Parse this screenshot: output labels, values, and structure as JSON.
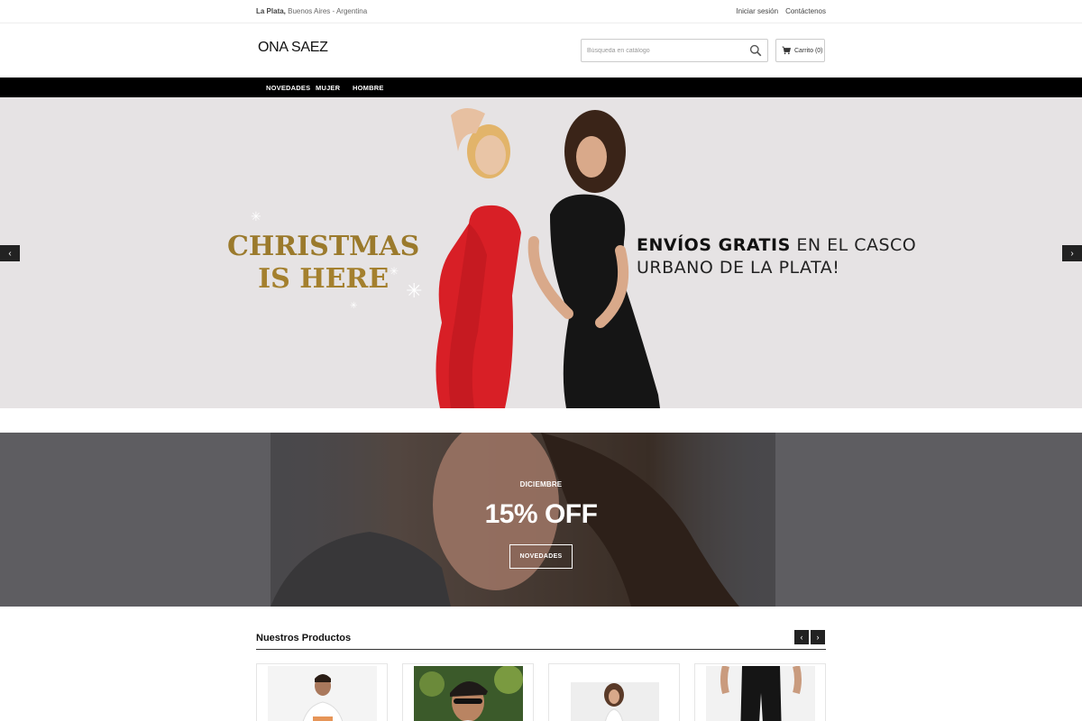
{
  "topbar": {
    "location_city": "La Plata,",
    "location_rest": " Buenos Aires - Argentina",
    "login": "Iniciar sesión",
    "contact": "Contáctenos"
  },
  "header": {
    "logo": "ONA SAEZ",
    "search_placeholder": "Búsqueda en catálogo",
    "cart_label": "Carrito (0)"
  },
  "nav": {
    "items": [
      "NOVEDADES",
      "MUJER",
      "HOMBRE"
    ]
  },
  "hero": {
    "xmas_line1": "CHRISTMAS",
    "xmas_line2": "IS HERE",
    "text_bold": "ENVÍOS GRATIS",
    "text_rest1": " EN EL CASCO",
    "text_line2": "URBANO DE LA PLATA!",
    "prev": "‹",
    "next": "›"
  },
  "promo": {
    "month": "DICIEMBRE",
    "offer": "15% OFF",
    "button": "NOVEDADES"
  },
  "products": {
    "title": "Nuestros Productos",
    "prev": "‹",
    "next": "›"
  },
  "colors": {
    "nav_bg": "#000000",
    "hero_bg": "#e6e3e4",
    "promo_bg": "#5e5d61",
    "xmas_gold": "#9b7a2c"
  }
}
